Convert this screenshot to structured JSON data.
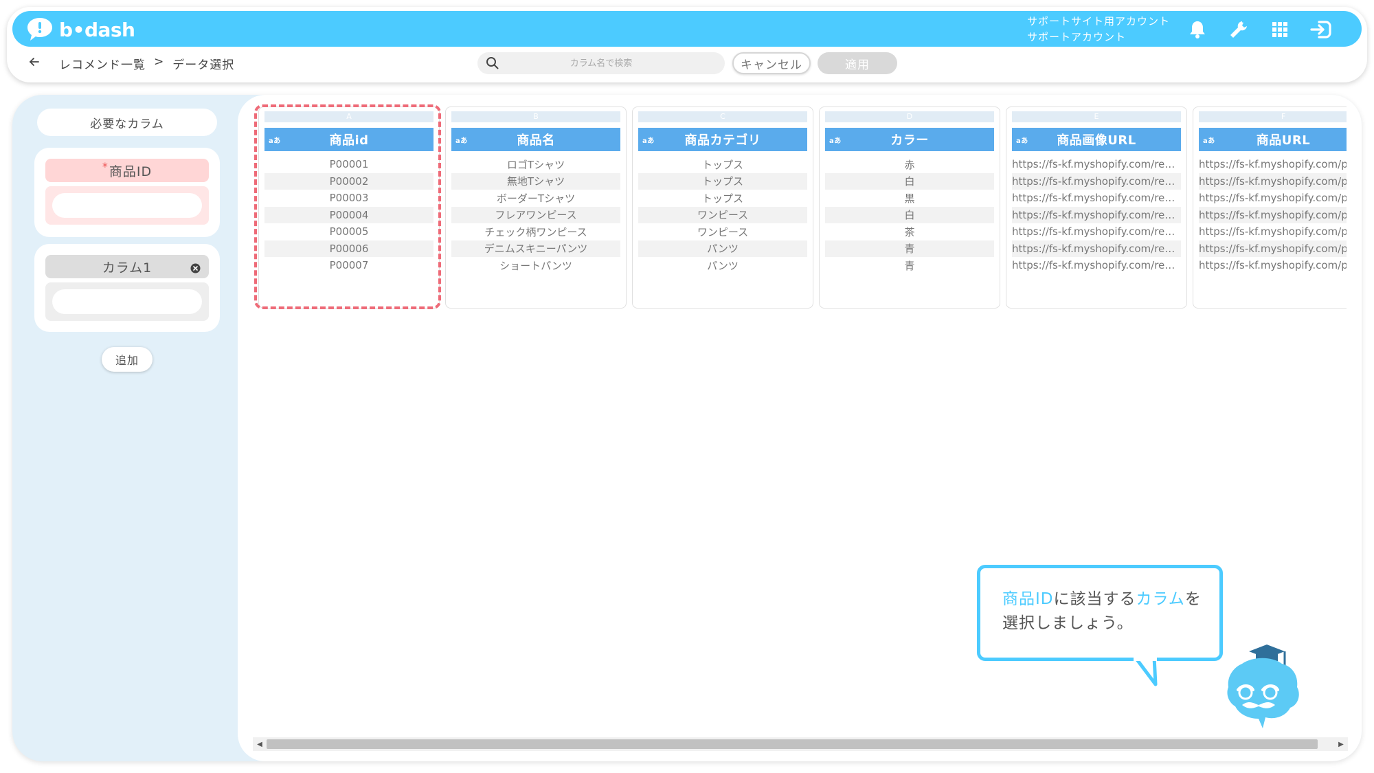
{
  "header": {
    "logo_text": "b•dash",
    "account_line1": "サポートサイト用アカウント",
    "account_line2": "サポートアカウント",
    "icons": [
      "bell-icon",
      "wrench-icon",
      "grid-icon",
      "logout-icon"
    ]
  },
  "toolbar": {
    "breadcrumb_1": "レコメンド一覧",
    "breadcrumb_sep": ">",
    "breadcrumb_2": "データ選択",
    "search_placeholder": "カラム名で検索",
    "cancel_label": "キャンセル",
    "apply_label": "適用"
  },
  "sidebar": {
    "required_label": "必要なカラム",
    "required_field_star": "*",
    "required_field": "商品ID",
    "optional_field": "カラム1",
    "add_label": "追加"
  },
  "table": {
    "type_tag": "aあ",
    "columns": [
      {
        "letter": "A",
        "header": "商品id",
        "cells": [
          "P00001",
          "P00002",
          "P00003",
          "P00004",
          "P00005",
          "P00006",
          "P00007"
        ]
      },
      {
        "letter": "B",
        "header": "商品名",
        "cells": [
          "ロゴTシャツ",
          "無地Tシャツ",
          "ボーダーTシャツ",
          "フレアワンピース",
          "チェック柄ワンピース",
          "デニムスキニーパンツ",
          "ショートパンツ"
        ]
      },
      {
        "letter": "C",
        "header": "商品カテゴリ",
        "cells": [
          "トップス",
          "トップス",
          "トップス",
          "ワンピース",
          "ワンピース",
          "パンツ",
          "パンツ"
        ]
      },
      {
        "letter": "D",
        "header": "カラー",
        "cells": [
          "赤",
          "白",
          "黒",
          "白",
          "茶",
          "青",
          "青"
        ]
      },
      {
        "letter": "E",
        "header": "商品画像URL",
        "cells": [
          "https://fs-kf.myshopify.com/re…",
          "https://fs-kf.myshopify.com/re…",
          "https://fs-kf.myshopify.com/re…",
          "https://fs-kf.myshopify.com/re…",
          "https://fs-kf.myshopify.com/re…",
          "https://fs-kf.myshopify.com/re…",
          "https://fs-kf.myshopify.com/re…"
        ]
      },
      {
        "letter": "F",
        "header": "商品URL",
        "cells": [
          "https://fs-kf.myshopify.com/pr",
          "https://fs-kf.myshopify.com/pr",
          "https://fs-kf.myshopify.com/pr",
          "https://fs-kf.myshopify.com/pr",
          "https://fs-kf.myshopify.com/pr",
          "https://fs-kf.myshopify.com/pr",
          "https://fs-kf.myshopify.com/pr"
        ]
      }
    ]
  },
  "bubble": {
    "part1": "商品ID",
    "part2": "に該当する",
    "part3": "カラム",
    "part4": "を",
    "line2": "選択しましょう。"
  },
  "colors": {
    "brand": "#4ccbff",
    "header_col": "#5aabec",
    "selection": "#ee6b78"
  }
}
